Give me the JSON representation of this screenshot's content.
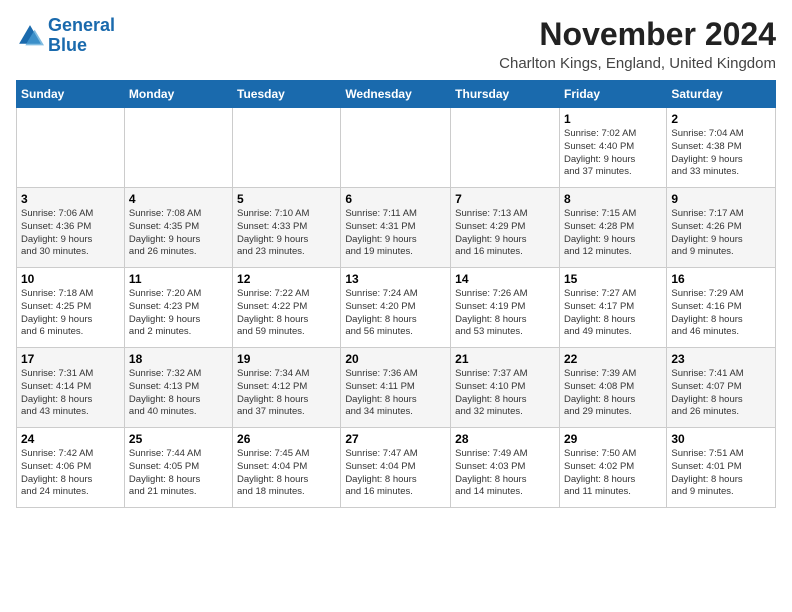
{
  "logo": {
    "line1": "General",
    "line2": "Blue"
  },
  "title": "November 2024",
  "subtitle": "Charlton Kings, England, United Kingdom",
  "weekdays": [
    "Sunday",
    "Monday",
    "Tuesday",
    "Wednesday",
    "Thursday",
    "Friday",
    "Saturday"
  ],
  "weeks": [
    [
      {
        "day": "",
        "info": ""
      },
      {
        "day": "",
        "info": ""
      },
      {
        "day": "",
        "info": ""
      },
      {
        "day": "",
        "info": ""
      },
      {
        "day": "",
        "info": ""
      },
      {
        "day": "1",
        "info": "Sunrise: 7:02 AM\nSunset: 4:40 PM\nDaylight: 9 hours\nand 37 minutes."
      },
      {
        "day": "2",
        "info": "Sunrise: 7:04 AM\nSunset: 4:38 PM\nDaylight: 9 hours\nand 33 minutes."
      }
    ],
    [
      {
        "day": "3",
        "info": "Sunrise: 7:06 AM\nSunset: 4:36 PM\nDaylight: 9 hours\nand 30 minutes."
      },
      {
        "day": "4",
        "info": "Sunrise: 7:08 AM\nSunset: 4:35 PM\nDaylight: 9 hours\nand 26 minutes."
      },
      {
        "day": "5",
        "info": "Sunrise: 7:10 AM\nSunset: 4:33 PM\nDaylight: 9 hours\nand 23 minutes."
      },
      {
        "day": "6",
        "info": "Sunrise: 7:11 AM\nSunset: 4:31 PM\nDaylight: 9 hours\nand 19 minutes."
      },
      {
        "day": "7",
        "info": "Sunrise: 7:13 AM\nSunset: 4:29 PM\nDaylight: 9 hours\nand 16 minutes."
      },
      {
        "day": "8",
        "info": "Sunrise: 7:15 AM\nSunset: 4:28 PM\nDaylight: 9 hours\nand 12 minutes."
      },
      {
        "day": "9",
        "info": "Sunrise: 7:17 AM\nSunset: 4:26 PM\nDaylight: 9 hours\nand 9 minutes."
      }
    ],
    [
      {
        "day": "10",
        "info": "Sunrise: 7:18 AM\nSunset: 4:25 PM\nDaylight: 9 hours\nand 6 minutes."
      },
      {
        "day": "11",
        "info": "Sunrise: 7:20 AM\nSunset: 4:23 PM\nDaylight: 9 hours\nand 2 minutes."
      },
      {
        "day": "12",
        "info": "Sunrise: 7:22 AM\nSunset: 4:22 PM\nDaylight: 8 hours\nand 59 minutes."
      },
      {
        "day": "13",
        "info": "Sunrise: 7:24 AM\nSunset: 4:20 PM\nDaylight: 8 hours\nand 56 minutes."
      },
      {
        "day": "14",
        "info": "Sunrise: 7:26 AM\nSunset: 4:19 PM\nDaylight: 8 hours\nand 53 minutes."
      },
      {
        "day": "15",
        "info": "Sunrise: 7:27 AM\nSunset: 4:17 PM\nDaylight: 8 hours\nand 49 minutes."
      },
      {
        "day": "16",
        "info": "Sunrise: 7:29 AM\nSunset: 4:16 PM\nDaylight: 8 hours\nand 46 minutes."
      }
    ],
    [
      {
        "day": "17",
        "info": "Sunrise: 7:31 AM\nSunset: 4:14 PM\nDaylight: 8 hours\nand 43 minutes."
      },
      {
        "day": "18",
        "info": "Sunrise: 7:32 AM\nSunset: 4:13 PM\nDaylight: 8 hours\nand 40 minutes."
      },
      {
        "day": "19",
        "info": "Sunrise: 7:34 AM\nSunset: 4:12 PM\nDaylight: 8 hours\nand 37 minutes."
      },
      {
        "day": "20",
        "info": "Sunrise: 7:36 AM\nSunset: 4:11 PM\nDaylight: 8 hours\nand 34 minutes."
      },
      {
        "day": "21",
        "info": "Sunrise: 7:37 AM\nSunset: 4:10 PM\nDaylight: 8 hours\nand 32 minutes."
      },
      {
        "day": "22",
        "info": "Sunrise: 7:39 AM\nSunset: 4:08 PM\nDaylight: 8 hours\nand 29 minutes."
      },
      {
        "day": "23",
        "info": "Sunrise: 7:41 AM\nSunset: 4:07 PM\nDaylight: 8 hours\nand 26 minutes."
      }
    ],
    [
      {
        "day": "24",
        "info": "Sunrise: 7:42 AM\nSunset: 4:06 PM\nDaylight: 8 hours\nand 24 minutes."
      },
      {
        "day": "25",
        "info": "Sunrise: 7:44 AM\nSunset: 4:05 PM\nDaylight: 8 hours\nand 21 minutes."
      },
      {
        "day": "26",
        "info": "Sunrise: 7:45 AM\nSunset: 4:04 PM\nDaylight: 8 hours\nand 18 minutes."
      },
      {
        "day": "27",
        "info": "Sunrise: 7:47 AM\nSunset: 4:04 PM\nDaylight: 8 hours\nand 16 minutes."
      },
      {
        "day": "28",
        "info": "Sunrise: 7:49 AM\nSunset: 4:03 PM\nDaylight: 8 hours\nand 14 minutes."
      },
      {
        "day": "29",
        "info": "Sunrise: 7:50 AM\nSunset: 4:02 PM\nDaylight: 8 hours\nand 11 minutes."
      },
      {
        "day": "30",
        "info": "Sunrise: 7:51 AM\nSunset: 4:01 PM\nDaylight: 8 hours\nand 9 minutes."
      }
    ]
  ]
}
